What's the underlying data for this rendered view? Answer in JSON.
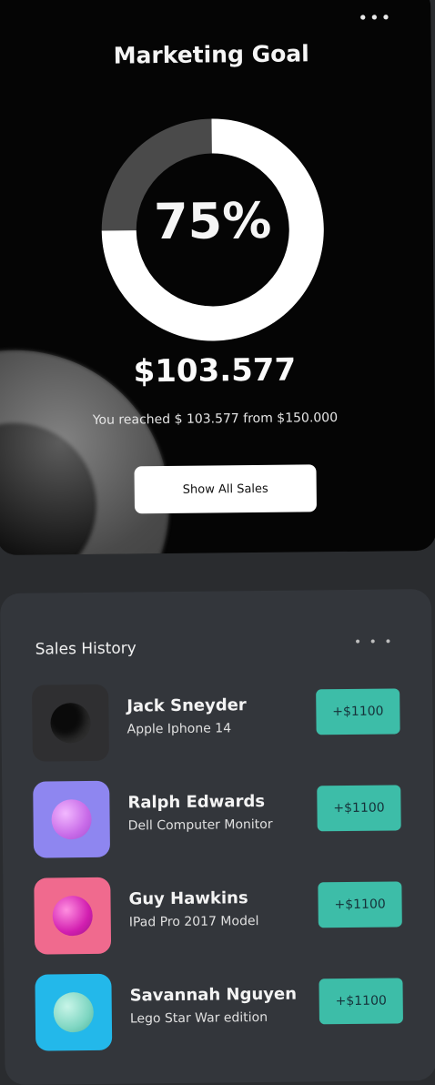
{
  "goal_card": {
    "menu_icon": "more-dots-icon",
    "title": "Marketing Goal",
    "progress_percent": 75,
    "progress_label": "75%",
    "amount": "$103.577",
    "reached_text": "You reached $ 103.577 from $150.000",
    "button_label": "Show All Sales",
    "colors": {
      "progress": "#ffffff",
      "track": "#4a4a4a",
      "background": "#050505"
    }
  },
  "history": {
    "title": "Sales History",
    "menu_icon": "more-dots-icon",
    "rows": [
      {
        "name": "Jack Sneyder",
        "product": "Apple Iphone 14",
        "price": "+$1100",
        "thumb_bg": "#2f2f31",
        "ball": "#0a0a0a"
      },
      {
        "name": "Ralph Edwards",
        "product": "Dell Computer Monitor",
        "price": "+$1100",
        "thumb_bg": "#8e86f0",
        "ball": "#d67cf0"
      },
      {
        "name": "Guy Hawkins",
        "product": "IPad Pro 2017 Model",
        "price": "+$1100",
        "thumb_bg": "#f06a8e",
        "ball": "#d21fb0"
      },
      {
        "name": "Savannah Nguyen",
        "product": "Lego Star War edition",
        "price": "+$1100",
        "thumb_bg": "#23b8ea",
        "ball": "#7fd6c2"
      }
    ],
    "colors": {
      "price_bg": "#3dbda8",
      "card_bg": "#33363b"
    }
  }
}
